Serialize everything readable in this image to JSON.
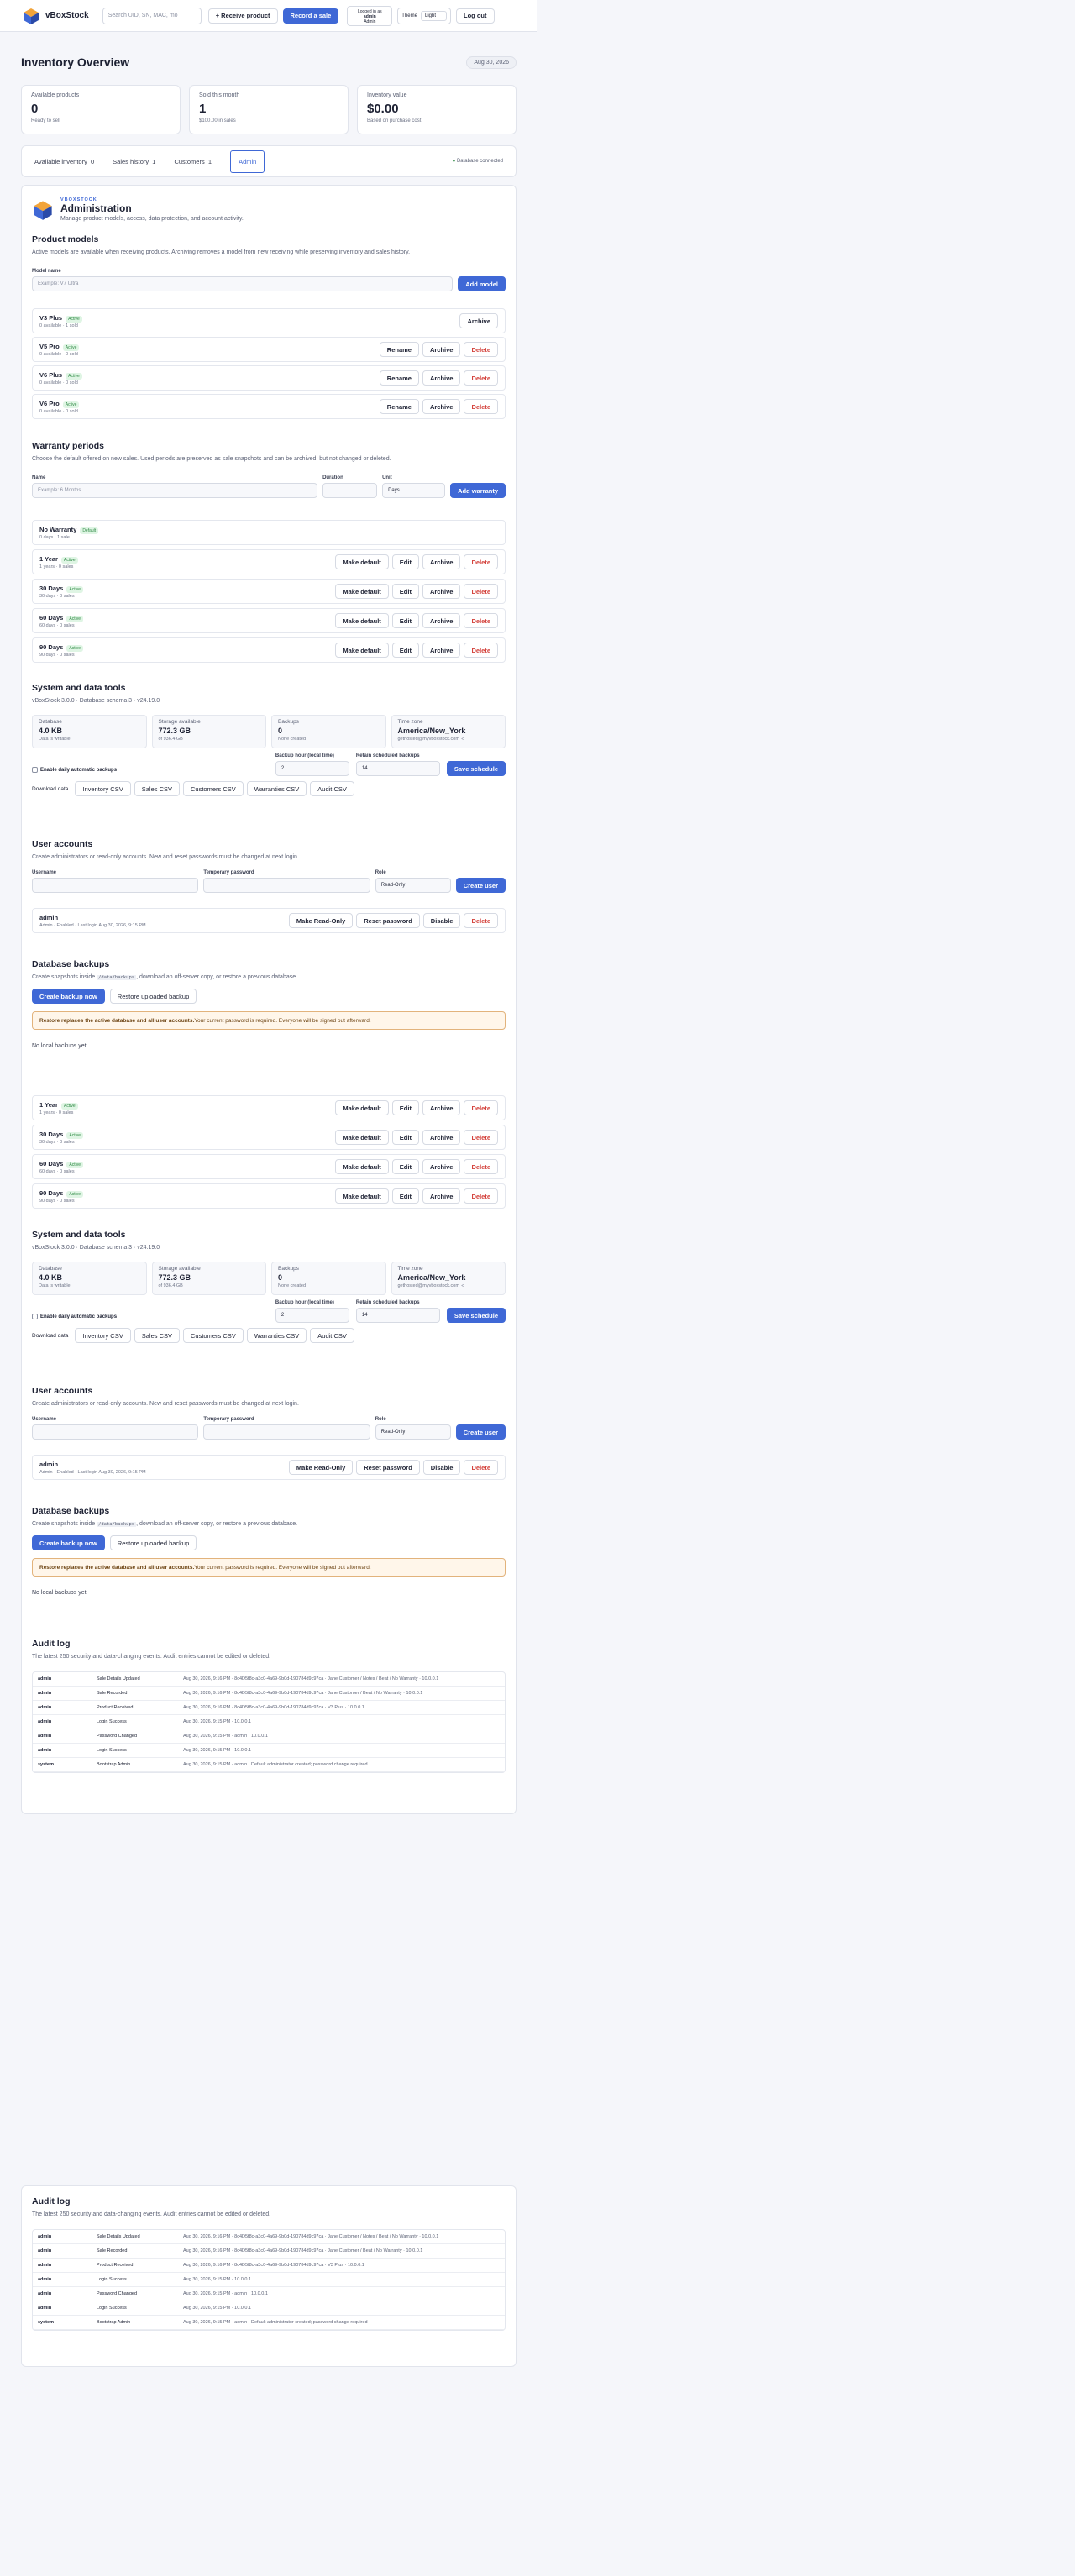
{
  "header": {
    "brand": "vBoxStock",
    "search_placeholder": "Search UID, SN, MAC, mo",
    "receive_label": "+ Receive product",
    "record_label": "Record a sale",
    "logged_in_as": "Logged in as",
    "user_name": "admin",
    "user_role": "Admin",
    "theme_label": "Theme",
    "theme_value": "Light",
    "logout_label": "Log out"
  },
  "overview": {
    "title": "Inventory Overview",
    "date": "Aug 30, 2026",
    "stats": [
      {
        "label": "Available products",
        "value": "0",
        "sub": "Ready to sell"
      },
      {
        "label": "Sold this month",
        "value": "1",
        "sub": "$100.00 in sales"
      },
      {
        "label": "Inventory value",
        "value": "$0.00",
        "sub": "Based on purchase cost"
      }
    ]
  },
  "tabs": [
    {
      "label": "Available inventory",
      "count": "0"
    },
    {
      "label": "Sales history",
      "count": "1"
    },
    {
      "label": "Customers",
      "count": "1"
    },
    {
      "label": "Admin",
      "count": ""
    }
  ],
  "db_status": "Database connected",
  "admin": {
    "eyebrow": "VBOXSTOCK",
    "title": "Administration",
    "desc": "Manage product models, access, data protection, and account activity."
  },
  "models": {
    "title": "Product models",
    "desc": "Active models are available when receiving products. Archiving removes a model from new receiving while preserving inventory and sales history.",
    "field_label": "Model name",
    "placeholder": "Example: V7 Ultra",
    "add_label": "Add model",
    "items": [
      {
        "name": "V3 Plus",
        "badge": "Active",
        "sub": "0 available · 1 sold",
        "rename": "",
        "archive": "Archive",
        "delete": ""
      },
      {
        "name": "V5 Pro",
        "badge": "Active",
        "sub": "0 available · 0 sold",
        "rename": "Rename",
        "archive": "Archive",
        "delete": "Delete"
      },
      {
        "name": "V6 Plus",
        "badge": "Active",
        "sub": "0 available · 0 sold",
        "rename": "Rename",
        "archive": "Archive",
        "delete": "Delete"
      },
      {
        "name": "V6 Pro",
        "badge": "Active",
        "sub": "0 available · 0 sold",
        "rename": "Rename",
        "archive": "Archive",
        "delete": "Delete"
      }
    ]
  },
  "warranty": {
    "title": "Warranty periods",
    "desc": "Choose the default offered on new sales. Used periods are preserved as sale snapshots and can be archived, but not changed or deleted.",
    "name_label": "Name",
    "name_placeholder": "Example: 6 Months",
    "duration_label": "Duration",
    "unit_label": "Unit",
    "unit_value": "Days",
    "add_label": "Add warranty",
    "default_item": {
      "name": "No Warranty",
      "badge": "Default",
      "sub": "0 days · 1 sale"
    },
    "items": [
      {
        "name": "1 Year",
        "badge": "Active",
        "sub": "1 years · 0 sales"
      },
      {
        "name": "30 Days",
        "badge": "Active",
        "sub": "30 days · 0 sales"
      },
      {
        "name": "60 Days",
        "badge": "Active",
        "sub": "60 days · 0 sales"
      },
      {
        "name": "90 Days",
        "badge": "Active",
        "sub": "90 days · 0 sales"
      }
    ],
    "make_default": "Make default",
    "edit": "Edit",
    "archive": "Archive",
    "delete": "Delete"
  },
  "system": {
    "title": "System and data tools",
    "version": "vBoxStock 3.0.0 · Database schema 3 · v24.19.0",
    "boxes": [
      {
        "label": "Database",
        "value": "4.0 KB",
        "sub": "Data is writable"
      },
      {
        "label": "Storage available",
        "value": "772.3 GB",
        "sub": "of 936.4 GB"
      },
      {
        "label": "Backups",
        "value": "0",
        "sub": "None created"
      },
      {
        "label": "Time zone",
        "value": "America/New_York",
        "sub": "gethosted@myvboxstock.com ·c"
      }
    ],
    "enable_label": "Enable daily automatic backups",
    "hour_label": "Backup hour (local time)",
    "hour_value": "2",
    "retain_label": "Retain scheduled backups",
    "retain_value": "14",
    "save_label": "Save schedule",
    "download_label": "Download data",
    "downloads": [
      "Inventory CSV",
      "Sales CSV",
      "Customers CSV",
      "Warranties CSV",
      "Audit CSV"
    ]
  },
  "users": {
    "title": "User accounts",
    "desc": "Create administrators or read-only accounts. New and reset passwords must be changed at next login.",
    "username_label": "Username",
    "password_label": "Temporary password",
    "role_label": "Role",
    "role_value": "Read-Only",
    "create_label": "Create user",
    "user": {
      "name": "admin",
      "sub": "Admin · Enabled · Last login Aug 30, 2026, 9:15 PM"
    },
    "make_readonly": "Make Read-Only",
    "reset": "Reset password",
    "disable": "Disable",
    "delete": "Delete"
  },
  "backups": {
    "title": "Database backups",
    "desc_pre": "Create snapshots inside",
    "desc_code": "/data/backups",
    "desc_post": ", download an off-server copy, or restore a previous database.",
    "create_label": "Create backup now",
    "restore_label": "Restore uploaded backup",
    "warn_bold": "Restore replaces the active database and all user accounts.",
    "warn_rest": " Your current password is required. Everyone will be signed out afterward.",
    "empty": "No local backups yet."
  },
  "audit": {
    "title": "Audit log",
    "desc": "The latest 250 security and data-changing events. Audit entries cannot be edited or deleted.",
    "rows": [
      {
        "user": "admin",
        "action": "Sale Details Updated",
        "detail": "Aug 30, 2026, 9:16 PM · 8c4D5f8c-a3c0-4a69-9b0d-190784d9c97ca · Jane Customer / Notes / Beat / No Warranty · 10.0.0.1"
      },
      {
        "user": "admin",
        "action": "Sale Recorded",
        "detail": "Aug 30, 2026, 9:16 PM · 8c4D5f8c-a3c0-4a69-9b0d-190784d9c97ca · Jane Customer / Beat / No Warranty · 10.0.0.1"
      },
      {
        "user": "admin",
        "action": "Product Received",
        "detail": "Aug 30, 2026, 9:16 PM · 8c4D5f8c-a3c0-4a69-9b0d-190784d9c97ca · V3 Plus · 10.0.0.1"
      },
      {
        "user": "admin",
        "action": "Login Success",
        "detail": "Aug 30, 2026, 9:15 PM · 10.0.0.1"
      },
      {
        "user": "admin",
        "action": "Password Changed",
        "detail": "Aug 30, 2026, 9:15 PM · admin · 10.0.0.1"
      },
      {
        "user": "admin",
        "action": "Login Success",
        "detail": "Aug 30, 2026, 9:15 PM · 10.0.0.1"
      },
      {
        "user": "system",
        "action": "Bootstrap Admin",
        "detail": "Aug 30, 2026, 9:15 PM · admin · Default administrator created; password change required"
      }
    ]
  }
}
